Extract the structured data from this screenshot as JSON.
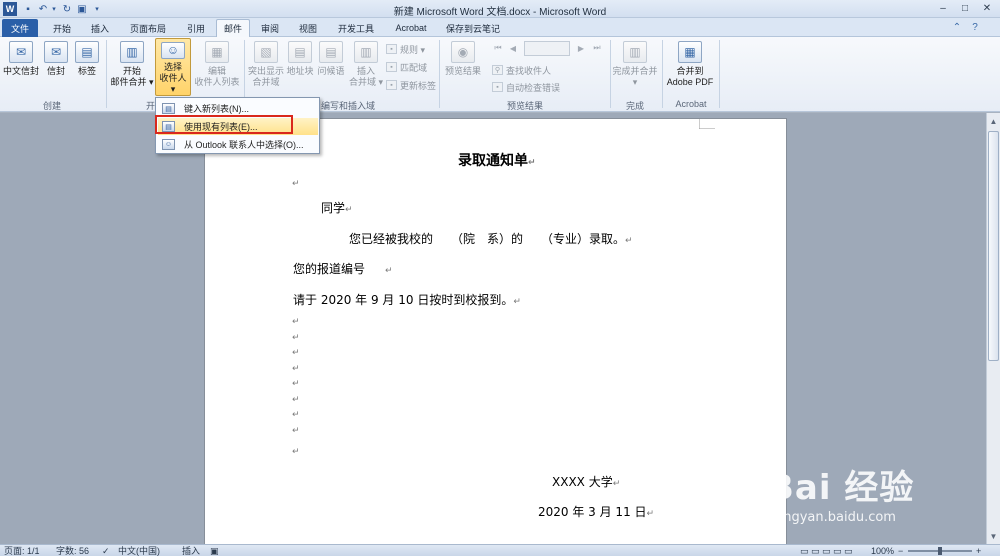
{
  "window": {
    "title": "新建 Microsoft Word 文档.docx - Microsoft Word",
    "app_icon": "W",
    "controls": {
      "minimize": "–",
      "maximize": "□",
      "close": "✕"
    }
  },
  "tabs": [
    {
      "label": "文件"
    },
    {
      "label": "开始"
    },
    {
      "label": "插入"
    },
    {
      "label": "页面布局"
    },
    {
      "label": "引用"
    },
    {
      "label": "邮件"
    },
    {
      "label": "审阅"
    },
    {
      "label": "视图"
    },
    {
      "label": "开发工具"
    },
    {
      "label": "Acrobat"
    },
    {
      "label": "保存到云笔记"
    }
  ],
  "ribbon": {
    "create": {
      "label": "创建",
      "chinese_envelope": "中文信封",
      "envelope": "信封",
      "labels": "标签"
    },
    "start_merge": {
      "label": "开始",
      "start_line1": "开始",
      "start_line2": "邮件合并 ▾",
      "select_line1": "选择",
      "select_line2": "收件人 ▾",
      "edit_line1": "编辑",
      "edit_line2": "收件人列表"
    },
    "write_insert": {
      "label": "编写和插入域",
      "highlight_line1": "突出显示",
      "highlight_line2": "合并域",
      "address_block": "地址块",
      "greeting": "问候语",
      "insert_line1": "插入",
      "insert_line2": "合并域 ▾",
      "rules": "规则 ▾",
      "match_fields": "匹配域",
      "update_labels": "更新标签"
    },
    "preview": {
      "label": "预览结果",
      "preview_results": "预览结果",
      "find_recipient": "查找收件人",
      "auto_check": "自动检查错误"
    },
    "finish": {
      "label": "完成",
      "finish_merge": "完成并合并 ▾"
    },
    "acrobat": {
      "label": "Acrobat",
      "merge_line1": "合并到",
      "merge_line2": "Adobe PDF"
    }
  },
  "dropdown": {
    "items": [
      {
        "label": "键入新列表(N)..."
      },
      {
        "label": "使用现有列表(E)..."
      },
      {
        "label": "从 Outlook 联系人中选择(O)..."
      }
    ]
  },
  "document": {
    "title": "录取通知单",
    "line_classmate": "同学",
    "line_admitted": "您已经被我校的　　（院　系）的　　（专业）录取。",
    "line_number": "您的报道编号",
    "line_report": "请于 2020 年 9 月 10 日按时到校报到。",
    "paragraph_mark": "↵",
    "university": "XXXX 大学",
    "date": "2020 年 3 月 11 日"
  },
  "status": {
    "page": "页面: 1/1",
    "words": "字数: 56",
    "language": "中文(中国)",
    "insert_mode": "插入",
    "zoom": "100%"
  },
  "watermark": {
    "main": "Bai 经验",
    "url": "jingyan.baidu.com"
  },
  "colors": {
    "file_tab": "#2a5fa8",
    "highlight": "#ffd36a",
    "annotation_box": "#d9281c"
  }
}
